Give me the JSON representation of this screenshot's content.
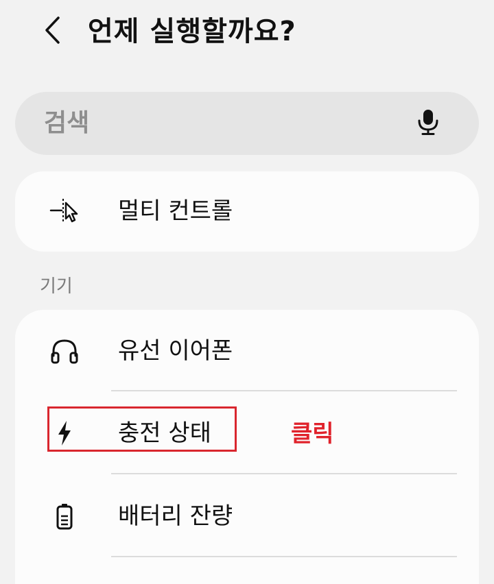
{
  "header": {
    "title": "언제 실행할까요?",
    "back_icon": "chevron-left-icon"
  },
  "search": {
    "placeholder": "검색",
    "mic_icon": "microphone-icon"
  },
  "top_card": {
    "items": [
      {
        "label": "멀티 컨트롤",
        "icon": "cursor-pointer-icon"
      }
    ]
  },
  "devices": {
    "section_label": "기기",
    "items": [
      {
        "label": "유선 이어폰",
        "icon": "headphones-icon"
      },
      {
        "label": "충전 상태",
        "icon": "lightning-bolt-icon"
      },
      {
        "label": "배터리 잔량",
        "icon": "battery-icon"
      }
    ]
  },
  "annotation": {
    "text": "클릭",
    "color": "#e0222b"
  },
  "colors": {
    "background": "#f2f2f2",
    "card": "#fcfcfc",
    "search_bg": "#e5e5e5",
    "highlight": "#d9262e"
  }
}
